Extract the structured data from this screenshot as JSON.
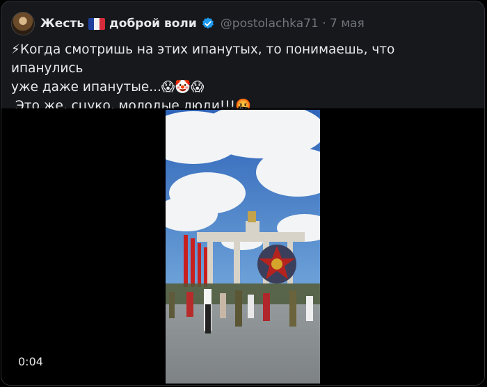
{
  "tweet": {
    "author_name": "Жесть",
    "author_name_suffix": "доброй воли",
    "handle": "@postolachka71",
    "separator": "·",
    "date": "7 мая",
    "text": "⚡Когда смотришь на этих ипанутых, то понимаешь, что ипанулись\nуже даже ипанутые...😱🤡😱\n Это же, сцуко, молодые люди!!!🤬"
  },
  "video": {
    "duration": "0:04"
  },
  "colors": {
    "background": "#000000",
    "card": "#16181c",
    "text": "#e7e9ea",
    "muted": "#71767b",
    "verified": "#1d9bf0"
  },
  "icons": [
    "avatar",
    "france-flag-icon",
    "verified-badge-icon"
  ]
}
